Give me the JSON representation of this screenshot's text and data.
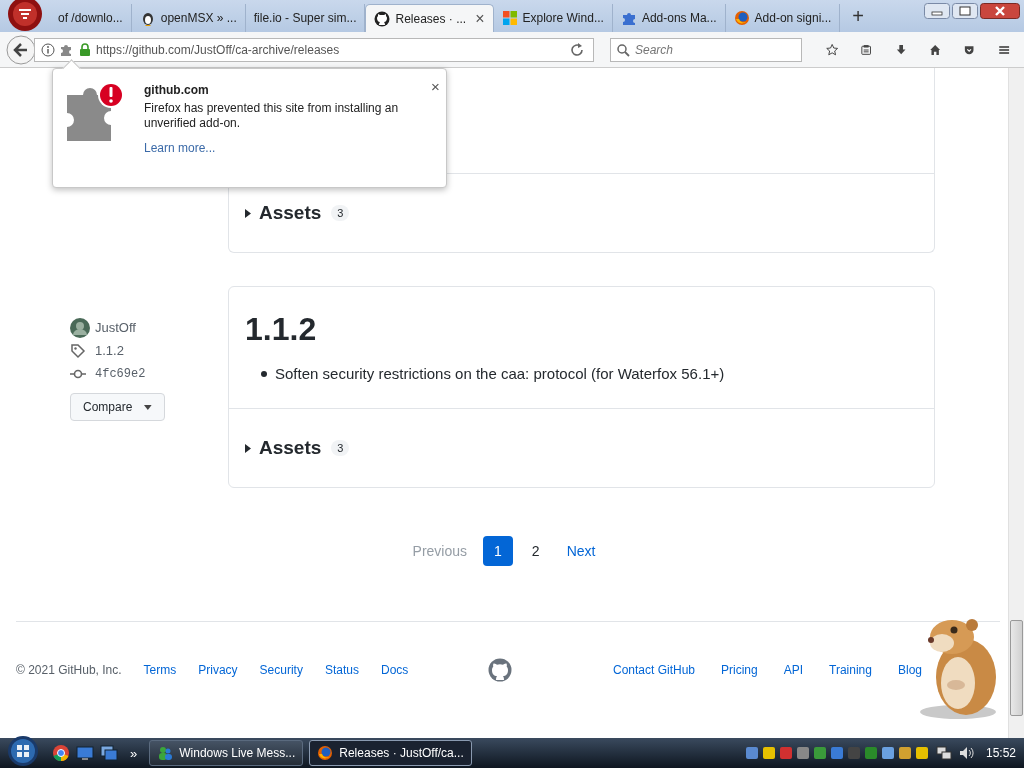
{
  "browser": {
    "tabs": [
      {
        "label": "of /downlo...",
        "selected": false
      },
      {
        "label": "openMSX » ...",
        "selected": false
      },
      {
        "label": "file.io - Super sim...",
        "selected": false
      },
      {
        "label": "Releases · ...",
        "selected": true,
        "close": "×"
      },
      {
        "label": "Explore Wind...",
        "selected": false
      },
      {
        "label": "Add-ons Ma...",
        "selected": false
      },
      {
        "label": "Add-on signi...",
        "selected": false
      }
    ],
    "new_tab_button": "+",
    "address_bar": {
      "url": "https://github.com/JustOff/ca-archive/releases"
    },
    "search_field": {
      "placeholder": "Search"
    }
  },
  "popup": {
    "title": "github.com",
    "message": "Firefox has prevented this site from installing an unverified add-on.",
    "link": "Learn more...",
    "close": "×"
  },
  "releases": [
    {
      "kind": "partial",
      "assets_label": "Assets",
      "assets_count": "3"
    },
    {
      "kind": "full",
      "author": "JustOff",
      "tag": "1.1.2",
      "commit": "4fc69e2",
      "compare_button": "Compare",
      "title": "1.1.2",
      "notes": [
        "Soften security restrictions on the caa: protocol (for Waterfox 56.1+)"
      ],
      "assets_label": "Assets",
      "assets_count": "3"
    }
  ],
  "pagination": {
    "previous": "Previous",
    "previous_disabled": true,
    "pages": [
      {
        "label": "1",
        "selected": true
      },
      {
        "label": "2",
        "selected": false
      }
    ],
    "next": "Next"
  },
  "footer": {
    "copyright": "© 2021 GitHub, Inc.",
    "left_links": [
      "Terms",
      "Privacy",
      "Security",
      "Status",
      "Docs"
    ],
    "right_links": [
      "Contact GitHub",
      "Pricing",
      "API",
      "Training",
      "Blog"
    ]
  },
  "taskbar": {
    "overflow": "»",
    "tasks": [
      {
        "label": "Windows Live Mess...",
        "selected": false
      },
      {
        "label": "Releases · JustOff/ca...",
        "selected": true
      }
    ],
    "clock": "15:52"
  }
}
